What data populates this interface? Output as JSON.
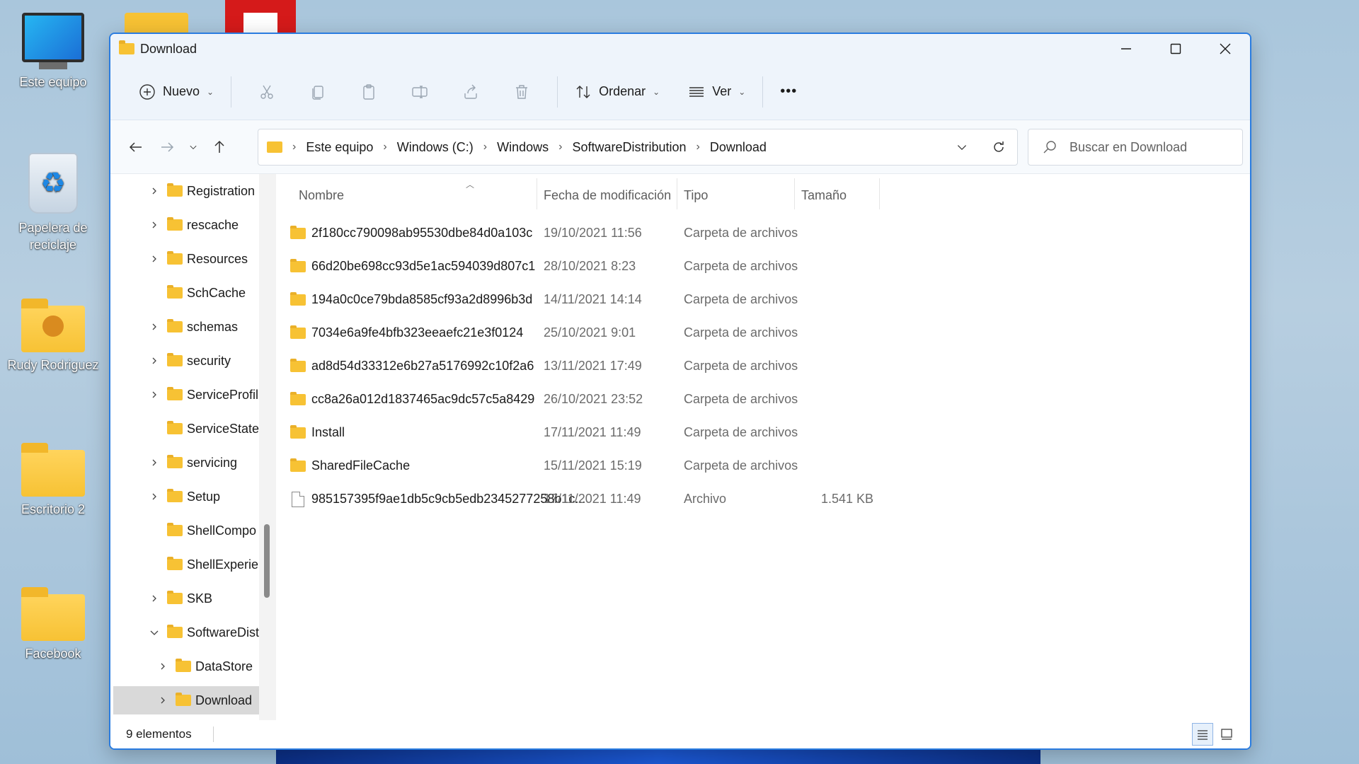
{
  "desktop": {
    "icons": [
      {
        "label": "Este equipo"
      },
      {
        "label": "Papelera de reciclaje"
      },
      {
        "label": "Rudy Rodriguez"
      },
      {
        "label": "Escritorio 2"
      },
      {
        "label": "Facebook"
      }
    ]
  },
  "window": {
    "title": "Download",
    "controls": {
      "minimize": "minimize-icon",
      "maximize": "maximize-icon",
      "close": "close-icon"
    }
  },
  "toolbar": {
    "new_label": "Nuevo",
    "sort_label": "Ordenar",
    "view_label": "Ver",
    "more_label": "•••"
  },
  "address": {
    "crumbs": [
      "Este equipo",
      "Windows (C:)",
      "Windows",
      "SoftwareDistribution",
      "Download"
    ]
  },
  "search": {
    "placeholder": "Buscar en Download"
  },
  "sidebar": {
    "items": [
      {
        "label": "Registration",
        "expandable": true
      },
      {
        "label": "rescache",
        "expandable": true
      },
      {
        "label": "Resources",
        "expandable": true
      },
      {
        "label": "SchCache",
        "expandable": false
      },
      {
        "label": "schemas",
        "expandable": true
      },
      {
        "label": "security",
        "expandable": true
      },
      {
        "label": "ServiceProfil",
        "expandable": true
      },
      {
        "label": "ServiceState",
        "expandable": false
      },
      {
        "label": "servicing",
        "expandable": true
      },
      {
        "label": "Setup",
        "expandable": true
      },
      {
        "label": "ShellCompo",
        "expandable": false
      },
      {
        "label": "ShellExperier",
        "expandable": false
      },
      {
        "label": "SKB",
        "expandable": true
      },
      {
        "label": "SoftwareDist",
        "expandable": true,
        "expanded": true
      },
      {
        "label": "DataStore",
        "expandable": true,
        "child": true
      },
      {
        "label": "Download",
        "expandable": true,
        "child": true,
        "selected": true
      }
    ]
  },
  "columns": {
    "name": "Nombre",
    "date": "Fecha de modificación",
    "type": "Tipo",
    "size": "Tamaño"
  },
  "files": [
    {
      "name": "2f180cc790098ab95530dbe84d0a103c",
      "date": "19/10/2021 11:56",
      "type": "Carpeta de archivos",
      "size": "",
      "kind": "folder"
    },
    {
      "name": "66d20be698cc93d5e1ac594039d807c1",
      "date": "28/10/2021 8:23",
      "type": "Carpeta de archivos",
      "size": "",
      "kind": "folder"
    },
    {
      "name": "194a0c0ce79bda8585cf93a2d8996b3d",
      "date": "14/11/2021 14:14",
      "type": "Carpeta de archivos",
      "size": "",
      "kind": "folder"
    },
    {
      "name": "7034e6a9fe4bfb323eeaefc21e3f0124",
      "date": "25/10/2021 9:01",
      "type": "Carpeta de archivos",
      "size": "",
      "kind": "folder"
    },
    {
      "name": "ad8d54d33312e6b27a5176992c10f2a6",
      "date": "13/11/2021 17:49",
      "type": "Carpeta de archivos",
      "size": "",
      "kind": "folder"
    },
    {
      "name": "cc8a26a012d1837465ac9dc57c5a8429",
      "date": "26/10/2021 23:52",
      "type": "Carpeta de archivos",
      "size": "",
      "kind": "folder"
    },
    {
      "name": "Install",
      "date": "17/11/2021 11:49",
      "type": "Carpeta de archivos",
      "size": "",
      "kind": "folder"
    },
    {
      "name": "SharedFileCache",
      "date": "15/11/2021 15:19",
      "type": "Carpeta de archivos",
      "size": "",
      "kind": "folder"
    },
    {
      "name": "985157395f9ae1db5c9cb5edb2345277258b1c...",
      "date": "17/11/2021 11:49",
      "type": "Archivo",
      "size": "1.541 KB",
      "kind": "file"
    }
  ],
  "status": {
    "count": "9 elementos"
  },
  "colors": {
    "accent": "#2a7ce0",
    "folder": "#f7c234"
  }
}
